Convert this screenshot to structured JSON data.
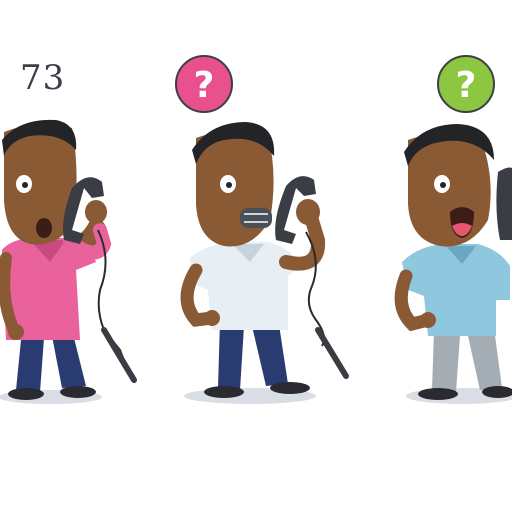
{
  "illustration": {
    "panels": [
      {
        "id": "left",
        "caption_number": "73",
        "bubble": null,
        "shirt_color": "#e9629c",
        "shirt_shadow": "#c94a82",
        "pants_color": "#2a3b72",
        "cord_color": "#2b2b2b",
        "expression": "surprised"
      },
      {
        "id": "middle",
        "caption_number": "",
        "bubble": {
          "symbol": "?",
          "color": "#e9508e"
        },
        "shirt_color": "#e7eef4",
        "shirt_shadow": "#c7d3de",
        "pants_color": "#2a3b72",
        "cord_color": "#2b2b2b",
        "expression": "talking"
      },
      {
        "id": "right",
        "caption_number": "",
        "bubble": {
          "symbol": "?",
          "color": "#8dc640"
        },
        "shirt_color": "#8ec7de",
        "shirt_shadow": "#6aa7c2",
        "pants_color": "#a4acb4",
        "cord_color": "#2b2b2b",
        "expression": "shouting"
      }
    ],
    "skin_color": "#8a5a34",
    "skin_shadow": "#6e4526",
    "hair_color": "#222428",
    "phone_color": "#3a3d44",
    "ground_shadow": "#d9dde4"
  }
}
